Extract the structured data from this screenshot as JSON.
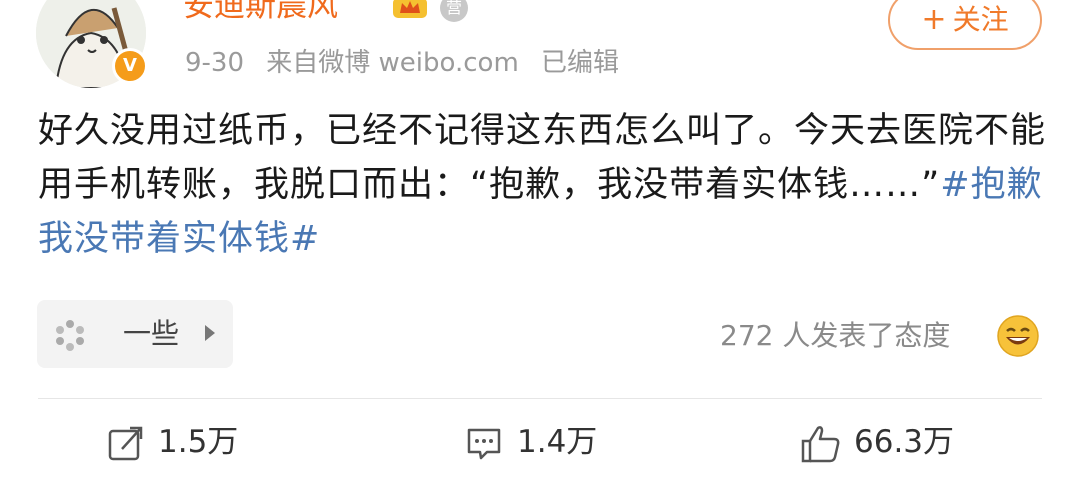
{
  "author": {
    "name": "安迪斯晨风",
    "verified_badge": "V",
    "avatar_icon": "cat-avatar-icon",
    "crown_icon": "crown-icon",
    "id_badge": "营"
  },
  "meta": {
    "date": "9-30",
    "source": "来自微博 weibo.com",
    "edited": "已编辑"
  },
  "follow_button": {
    "plus": "+",
    "label": "关注"
  },
  "post": {
    "text": "好久没用过纸币，已经不记得这东西怎么叫了。今天去医院不能用手机转账，我脱口而出：“抱歉，我没带着实体钱……”",
    "hashtag": "#抱歉我没带着实体钱#"
  },
  "reaction_chip": {
    "label": "一些",
    "icon": "sparkle-icon"
  },
  "attitude": {
    "text": "272 人发表了态度",
    "icon": "grin-emoji-icon"
  },
  "actions": {
    "repost": {
      "icon": "repost-icon",
      "count": "1.5万"
    },
    "comment": {
      "icon": "comment-icon",
      "count": "1.4万"
    },
    "like": {
      "icon": "thumbs-up-icon",
      "count": "66.3万"
    }
  },
  "colors": {
    "username": "#f06a1c",
    "hashtag": "#4a78b4",
    "follow_border": "#f0a06a",
    "meta": "#9a9a9a"
  }
}
